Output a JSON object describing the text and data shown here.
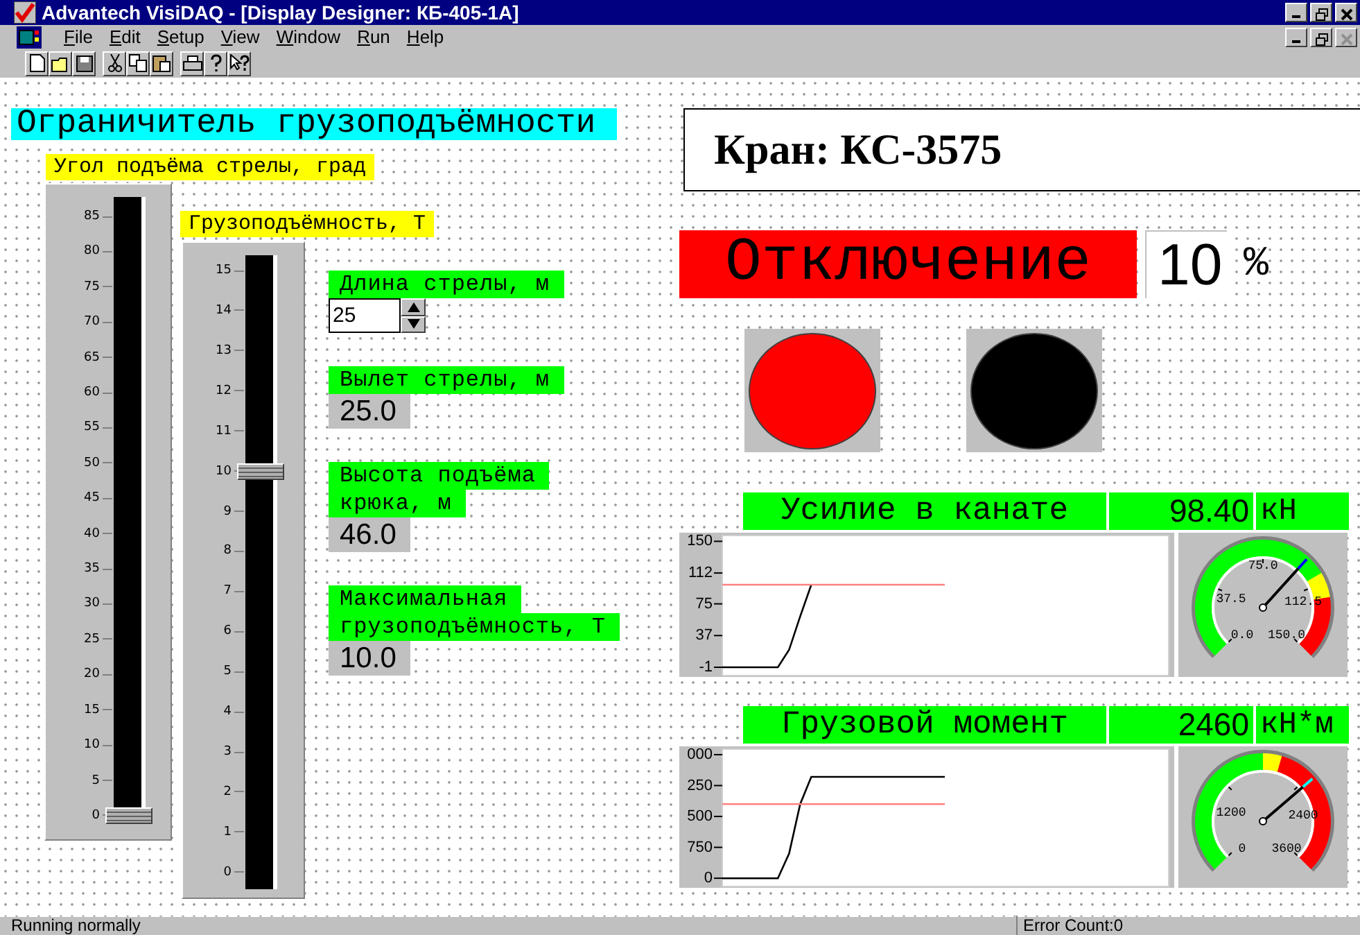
{
  "window": {
    "title": "Advantech VisiDAQ - [Display Designer: КБ-405-1А]"
  },
  "menu": [
    "File",
    "Edit",
    "Setup",
    "View",
    "Window",
    "Run",
    "Help"
  ],
  "panel_title": "Ограничитель грузоподъёмности",
  "crane_title": "Кран: КС-3575",
  "sliders": [
    {
      "label": "Угол подъёма стрелы, град",
      "ticks": [
        "85",
        "80",
        "75",
        "70",
        "65",
        "60",
        "55",
        "50",
        "45",
        "40",
        "35",
        "30",
        "25",
        "20",
        "15",
        "10",
        "5",
        "0"
      ],
      "level": 0
    },
    {
      "label": "Грузоподъёмность, Т",
      "ticks": [
        "15",
        "14",
        "13",
        "12",
        "11",
        "10",
        "9",
        "8",
        "7",
        "6",
        "5",
        "4",
        "3",
        "2",
        "1",
        "0"
      ],
      "level": 0.667
    }
  ],
  "readouts": [
    {
      "kind": "spin",
      "label": [
        "Длина стрелы, м"
      ],
      "value": "25"
    },
    {
      "kind": "display",
      "label": [
        "Вылет стрелы, м"
      ],
      "value": "25.0"
    },
    {
      "kind": "display",
      "label": [
        "Высота подъёма",
        "крюка, м"
      ],
      "value": "46.0"
    },
    {
      "kind": "display",
      "label": [
        "Максимальная",
        "грузоподъёмность, Т"
      ],
      "value": "10.0"
    }
  ],
  "alarm": {
    "label": "Отключение",
    "active": true,
    "value": "10",
    "unit": "%"
  },
  "lamps": [
    {
      "on": true
    },
    {
      "on": false
    }
  ],
  "meters": [
    {
      "title": "Усилие в канате",
      "value": "98.40",
      "unit": "кН",
      "chart_data": {
        "type": "line",
        "categories": [
          null,
          null,
          null,
          null,
          null,
          null,
          null,
          null,
          null,
          null,
          null,
          null,
          null,
          null,
          null,
          null,
          null,
          null,
          null,
          null,
          null,
          null,
          null,
          null,
          null,
          null,
          null,
          null,
          null,
          null,
          null,
          null,
          null,
          null,
          null,
          null,
          null,
          null,
          null,
          null,
          null
        ],
        "ylim": [
          -11,
          157
        ],
        "yticks": [
          150,
          112,
          75,
          37,
          -1
        ],
        "series": [
          {
            "color": "#000000",
            "values": [
              -1,
              -1,
              -1,
              -1,
              -1,
              -1,
              20,
              60,
              98,
              null,
              null,
              null,
              null,
              null,
              null,
              null,
              null,
              null,
              null,
              null,
              null,
              null,
              null,
              null,
              null,
              null,
              null,
              null,
              null,
              null,
              null,
              null,
              null,
              null,
              null,
              null,
              null,
              null,
              null,
              null,
              null
            ]
          },
          {
            "color": "#ff8080",
            "values": [
              98,
              98,
              98,
              98,
              98,
              98,
              98,
              98,
              98,
              98,
              98,
              98,
              98,
              98,
              98,
              98,
              98,
              98,
              98,
              98,
              98,
              null,
              null,
              null,
              null,
              null,
              null,
              null,
              null,
              null,
              null,
              null,
              null,
              null,
              null,
              null,
              null,
              null,
              null,
              null,
              null
            ]
          }
        ]
      },
      "gauge": {
        "labels": [
          "75.0",
          "37.5",
          "112.5",
          "0.0",
          "150.0"
        ],
        "level": 0.656
      }
    },
    {
      "title": "Грузовой момент",
      "value": "2460",
      "unit": "кН*м",
      "chart_data": {
        "type": "line",
        "categories": [
          null,
          null,
          null,
          null,
          null,
          null,
          null,
          null,
          null,
          null,
          null,
          null,
          null,
          null,
          null,
          null,
          null,
          null,
          null,
          null,
          null,
          null,
          null,
          null,
          null,
          null,
          null,
          null,
          null,
          null,
          null,
          null,
          null,
          null,
          null,
          null,
          null,
          null,
          null,
          null,
          null
        ],
        "ylim": [
          -200,
          3135
        ],
        "yticks": [
          750,
          0
        ],
        "series": [
          {
            "color": "#000000",
            "values": [
              0,
              0,
              0,
              0,
              0,
              0,
              600,
              1800,
              2460,
              2460,
              2460,
              2460,
              2460,
              2460,
              2460,
              2460,
              2460,
              2460,
              2460,
              2460,
              2460,
              null,
              null,
              null,
              null,
              null,
              null,
              null,
              null,
              null,
              null,
              null,
              null,
              null,
              null,
              null,
              null,
              null,
              null,
              null,
              null
            ]
          },
          {
            "color": "#ff8080",
            "values": [
              1800,
              1800,
              1800,
              1800,
              1800,
              1800,
              1800,
              1800,
              1800,
              1800,
              1800,
              1800,
              1800,
              1800,
              1800,
              1800,
              1800,
              1800,
              1800,
              1800,
              1800,
              null,
              null,
              null,
              null,
              null,
              null,
              null,
              null,
              null,
              null,
              null,
              null,
              null,
              null,
              null,
              null,
              null,
              null,
              null,
              null
            ]
          }
        ]
      },
      "gauge": {
        "labels": [
          "1200",
          "2400",
          "0",
          "3600"
        ],
        "level": 0.683
      },
      "cut_tick_labels": [
        "000",
        "250",
        "500"
      ]
    }
  ],
  "status_bar": {
    "message": "Running normally",
    "error_count": "Error Count:0"
  }
}
